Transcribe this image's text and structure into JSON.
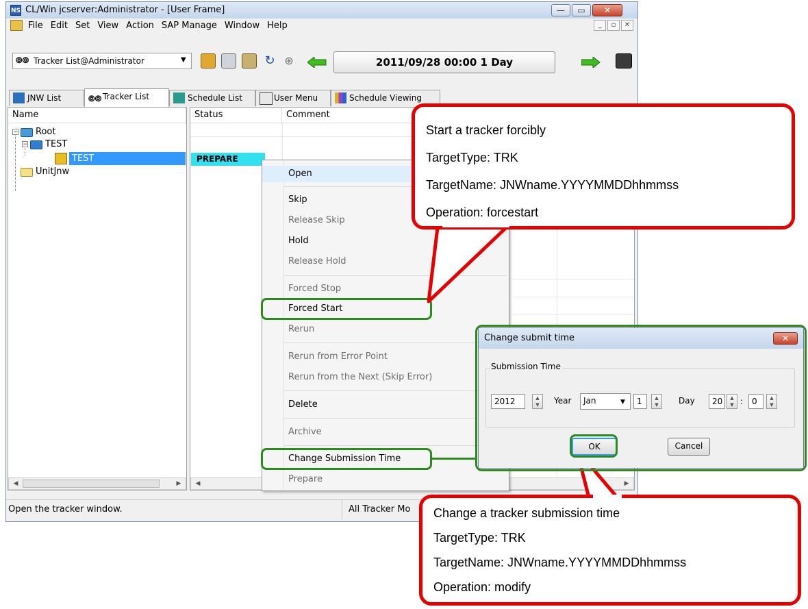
{
  "window": {
    "title": "CL/Win jcserver:Administrator - [User Frame]",
    "app_icon": "NS",
    "controls": [
      "—",
      "▭",
      "✕"
    ]
  },
  "menu": {
    "items": [
      "File",
      "Edit",
      "Set",
      "View",
      "Action",
      "SAP Manage",
      "Window",
      "Help"
    ],
    "mdi_controls": [
      "_",
      "▫",
      "✕"
    ]
  },
  "toolbar": {
    "combo_icon": "binoculars-icon",
    "combo_value": "Tracker List@Administrator",
    "date_text": "2011/09/28 00:00  1 Day"
  },
  "tabs": [
    {
      "label": "JNW List",
      "icon": "jnw-icon"
    },
    {
      "label": "Tracker List",
      "icon": "binoculars-icon"
    },
    {
      "label": "Schedule List",
      "icon": "schedule-icon"
    },
    {
      "label": "User Menu",
      "icon": "user-menu-icon"
    },
    {
      "label": "Schedule Viewing",
      "icon": "viewing-icon"
    }
  ],
  "tree": {
    "header": "Name",
    "nodes": [
      "Root",
      "TEST",
      "TEST",
      "UnitJnw"
    ]
  },
  "list": {
    "headers": [
      "Status",
      "Comment"
    ],
    "status_value": "PREPARE"
  },
  "context_menu": {
    "open": "Open",
    "skip": "Skip",
    "release_skip": "Release Skip",
    "hold": "Hold",
    "release_hold": "Release Hold",
    "forced_stop": "Forced Stop",
    "forced_start": "Forced Start",
    "rerun": "Rerun",
    "rerun_error": "Rerun from Error Point",
    "rerun_next": "Rerun from the Next (Skip Error)",
    "delete": "Delete",
    "archive": "Archive",
    "change_time": "Change Submission Time",
    "prepare": "Prepare"
  },
  "statusbar": {
    "left": "Open the tracker window.",
    "right": "All Tracker Mo"
  },
  "dialog": {
    "title": "Change submit time",
    "group": "Submission Time",
    "year_value": "2012",
    "year_label": "Year",
    "month_value": "Jan",
    "day_value": "1",
    "day_label": "Day",
    "hour_value": "20",
    "colon": ":",
    "minute_value": "0",
    "ok": "OK",
    "cancel": "Cancel"
  },
  "callout_top": {
    "line1": "Start a tracker forcibly",
    "line2": "TargetType: TRK",
    "line3": "TargetName: JNWname.YYYYMMDDhhmmss",
    "line4": "Operation: forcestart"
  },
  "callout_bottom": {
    "line1": "Change a tracker submission time",
    "line2": "TargetType: TRK",
    "line3": "TargetName: JNWname.YYYYMMDDhhmmss",
    "line4": "Operation: modify"
  },
  "colors": {
    "callout_border": "#e60000",
    "highlight_border": "#2b8a1e",
    "selection": "#3399ff",
    "status_cell": "#33e0f0"
  }
}
